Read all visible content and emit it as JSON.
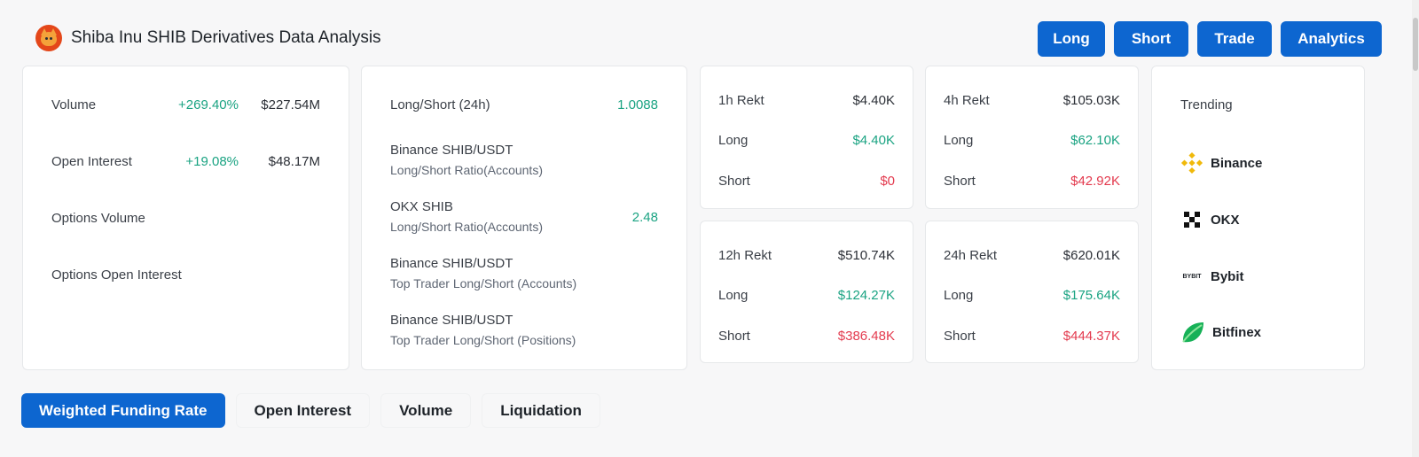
{
  "header": {
    "title": "Shiba Inu SHIB Derivatives Data Analysis",
    "icon": "shiba-inu-coin-icon"
  },
  "top_buttons": [
    "Long",
    "Short",
    "Trade",
    "Analytics"
  ],
  "stats": {
    "volume": {
      "label": "Volume",
      "change": "+269.40%",
      "value": "$227.54M"
    },
    "open_interest": {
      "label": "Open Interest",
      "change": "+19.08%",
      "value": "$48.17M"
    },
    "options_volume": {
      "label": "Options Volume"
    },
    "options_open_interest": {
      "label": "Options Open Interest"
    }
  },
  "ratios": {
    "long_short_24h": {
      "label": "Long/Short (24h)",
      "value": "1.0088"
    },
    "binance_accounts": {
      "title": "Binance SHIB/USDT",
      "sub": "Long/Short Ratio(Accounts)"
    },
    "okx_accounts": {
      "title": "OKX SHIB",
      "sub": "Long/Short Ratio(Accounts)",
      "value": "2.48"
    },
    "binance_top_accounts": {
      "title": "Binance SHIB/USDT",
      "sub": "Top Trader Long/Short (Accounts)"
    },
    "binance_top_positions": {
      "title": "Binance SHIB/USDT",
      "sub": "Top Trader Long/Short (Positions)"
    }
  },
  "rekt": {
    "long_label": "Long",
    "short_label": "Short",
    "h1": {
      "label": "1h Rekt",
      "total": "$4.40K",
      "long": "$4.40K",
      "short": "$0"
    },
    "h4": {
      "label": "4h Rekt",
      "total": "$105.03K",
      "long": "$62.10K",
      "short": "$42.92K"
    },
    "h12": {
      "label": "12h Rekt",
      "total": "$510.74K",
      "long": "$124.27K",
      "short": "$386.48K"
    },
    "h24": {
      "label": "24h Rekt",
      "total": "$620.01K",
      "long": "$175.64K",
      "short": "$444.37K"
    }
  },
  "trending": {
    "title": "Trending",
    "items": [
      {
        "name": "Binance",
        "icon": "binance-icon"
      },
      {
        "name": "OKX",
        "icon": "okx-icon"
      },
      {
        "name": "Bybit",
        "icon": "bybit-icon",
        "icon_text": "BYBIT"
      },
      {
        "name": "Bitfinex",
        "icon": "bitfinex-icon"
      }
    ]
  },
  "tabs": [
    "Weighted Funding Rate",
    "Open Interest",
    "Volume",
    "Liquidation"
  ],
  "colors": {
    "accent": "#0d66d0",
    "positive": "#1aa382",
    "negative": "#e33a4e"
  }
}
